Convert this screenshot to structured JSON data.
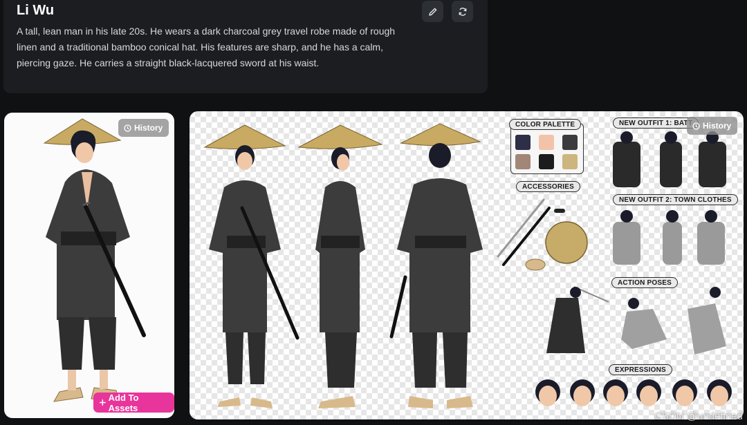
{
  "character": {
    "name": "Li Wu",
    "description": "A tall, lean man in his late 20s. He wears a dark charcoal grey travel robe made of rough linen and a traditional bamboo conical hat. His features are sharp, and he has a calm, piercing gaze. He carries a straight black-lacquered sword at his waist."
  },
  "actions": {
    "edit_icon": "pencil-icon",
    "regenerate_icon": "refresh-icon"
  },
  "portrait_card": {
    "history_label": "History",
    "add_assets_label": "Add To Assets"
  },
  "sheet_card": {
    "history_label": "History",
    "labels": {
      "color_palette": "COLOR PALETTE",
      "accessories": "ACCESSORIES",
      "outfit1": "NEW OUTFIT 1: BATT",
      "outfit2": "NEW OUTFIT 2: TOWN CLOTHES",
      "action_poses": "ACTION POSES",
      "expressions": "EXPRESSIONS"
    },
    "palette": [
      "#2c2f45",
      "#f2c3a8",
      "#3b3b3d",
      "#a28676",
      "#1c1c1c",
      "#cdb57e"
    ]
  },
  "watermark": "CSDN @undefined",
  "colors": {
    "accent": "#e8359b",
    "background": "#101112",
    "panel": "#1b1d20"
  }
}
